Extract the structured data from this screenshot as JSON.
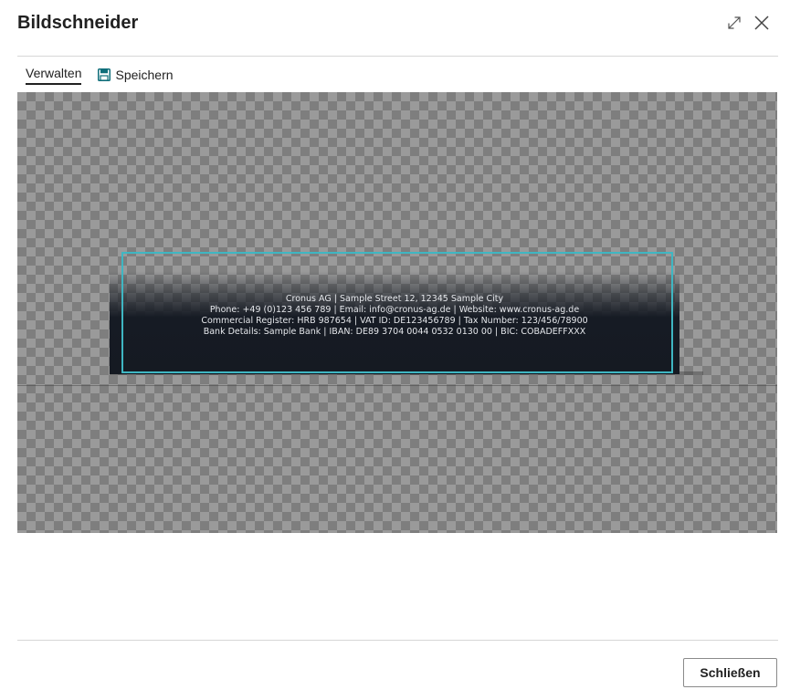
{
  "dialog": {
    "title": "Bildschneider"
  },
  "actions": {
    "manage_label": "Verwalten",
    "save_label": "Speichern"
  },
  "image": {
    "banner_lines": [
      "Cronus AG | Sample Street 12, 12345 Sample City",
      "Phone: +49 (0)123 456 789 | Email: info@cronus-ag.de | Website: www.cronus-ag.de",
      "Commercial Register: HRB 987654 | VAT ID: DE123456789 | Tax Number: 123/456/78900",
      "Bank Details: Sample Bank | IBAN: DE89 3704 0044 0532 0130 00 | BIC: COBADEFFXXX"
    ]
  },
  "footer": {
    "close_label": "Schließen"
  },
  "icons": {
    "expand": "expand-icon",
    "close": "close-icon",
    "save": "floppy-disk-icon"
  },
  "colors": {
    "crop_frame": "#3fb6c2",
    "save_icon": "#0f6e7a",
    "banner_bg": "#161b24"
  }
}
